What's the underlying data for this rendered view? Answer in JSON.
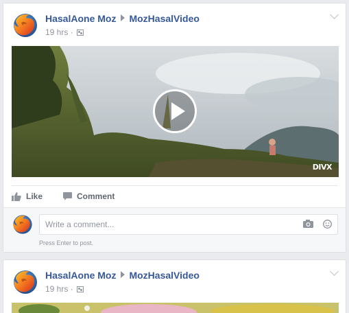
{
  "posts": [
    {
      "author": "HasalAone Moz",
      "target": "MozHasalVideo",
      "time": "19 hrs ·",
      "video_badge": "DIVX",
      "actions": {
        "like": "Like",
        "comment": "Comment"
      },
      "comment_placeholder": "Write a comment...",
      "comment_hint": "Press Enter to post."
    },
    {
      "author": "HasalAone Moz",
      "target": "MozHasalVideo",
      "time": "19 hrs ·"
    }
  ],
  "icons": [
    "firefox-logo",
    "audience-icon",
    "chevron-down-icon",
    "play-icon",
    "like-icon",
    "comment-icon",
    "camera-icon",
    "smiley-icon"
  ],
  "colors": {
    "link": "#365899",
    "muted": "#90949c",
    "background": "#e9ebee"
  }
}
